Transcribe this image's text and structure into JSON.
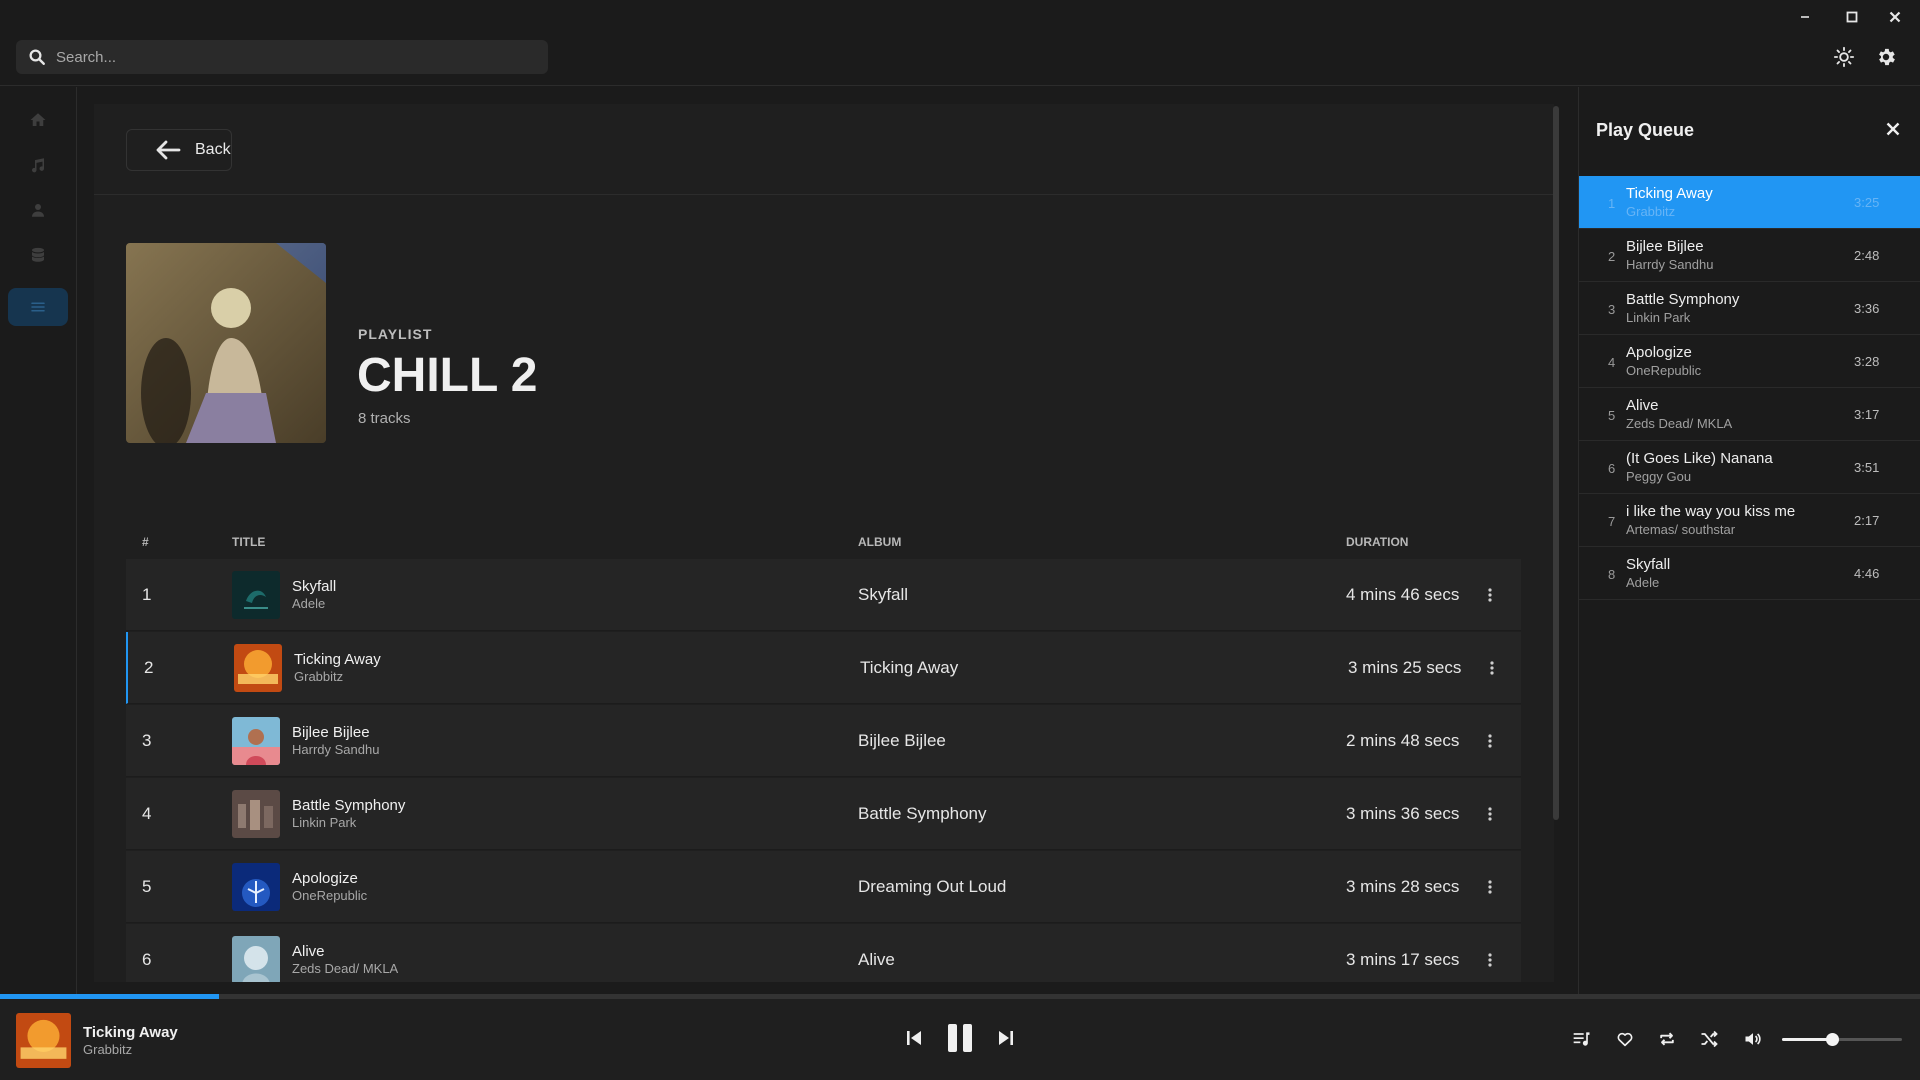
{
  "search": {
    "placeholder": "Search..."
  },
  "window_controls": [
    "minimize-icon",
    "maximize-icon",
    "close-icon"
  ],
  "top_icons": [
    "sun-icon",
    "gear-icon"
  ],
  "nav": {
    "items": [
      {
        "icon": "home-icon",
        "active": false
      },
      {
        "icon": "music-note-icon",
        "active": false
      },
      {
        "icon": "person-icon",
        "active": false
      },
      {
        "icon": "database-icon",
        "active": false
      },
      {
        "icon": "list-icon",
        "active": true
      }
    ]
  },
  "main": {
    "back_label": "Back",
    "playlist": {
      "type_label": "PLAYLIST",
      "title": "CHILL 2",
      "count_label": "8 tracks"
    },
    "table": {
      "headers": {
        "num": "#",
        "title": "TITLE",
        "album": "ALBUM",
        "duration": "DURATION"
      },
      "rows": [
        {
          "num": "1",
          "title": "Skyfall",
          "artist": "Adele",
          "album": "Skyfall",
          "duration": "4 mins 46 secs",
          "playing": false
        },
        {
          "num": "2",
          "title": "Ticking Away",
          "artist": "Grabbitz",
          "album": "Ticking Away",
          "duration": "3 mins 25 secs",
          "playing": true
        },
        {
          "num": "3",
          "title": "Bijlee Bijlee",
          "artist": "Harrdy Sandhu",
          "album": "Bijlee Bijlee",
          "duration": "2 mins 48 secs",
          "playing": false
        },
        {
          "num": "4",
          "title": "Battle Symphony",
          "artist": "Linkin Park",
          "album": "Battle Symphony",
          "duration": "3 mins 36 secs",
          "playing": false
        },
        {
          "num": "5",
          "title": "Apologize",
          "artist": "OneRepublic",
          "album": "Dreaming Out Loud",
          "duration": "3 mins 28 secs",
          "playing": false
        },
        {
          "num": "6",
          "title": "Alive",
          "artist": "Zeds Dead/ MKLA",
          "album": "Alive",
          "duration": "3 mins 17 secs",
          "playing": false
        }
      ]
    }
  },
  "queue": {
    "title": "Play Queue",
    "items": [
      {
        "num": "1",
        "title": "Ticking Away",
        "artist": "Grabbitz",
        "duration": "3:25",
        "current": true
      },
      {
        "num": "2",
        "title": "Bijlee Bijlee",
        "artist": "Harrdy Sandhu",
        "duration": "2:48",
        "current": false
      },
      {
        "num": "3",
        "title": "Battle Symphony",
        "artist": "Linkin Park",
        "duration": "3:36",
        "current": false
      },
      {
        "num": "4",
        "title": "Apologize",
        "artist": "OneRepublic",
        "duration": "3:28",
        "current": false
      },
      {
        "num": "5",
        "title": "Alive",
        "artist": "Zeds Dead/ MKLA",
        "duration": "3:17",
        "current": false
      },
      {
        "num": "6",
        "title": "(It Goes Like) Nanana",
        "artist": "Peggy Gou",
        "duration": "3:51",
        "current": false
      },
      {
        "num": "7",
        "title": "i like the way you kiss me",
        "artist": "Artemas/ southstar",
        "duration": "2:17",
        "current": false
      },
      {
        "num": "8",
        "title": "Skyfall",
        "artist": "Adele",
        "duration": "4:46",
        "current": false
      }
    ]
  },
  "player": {
    "now_playing": {
      "title": "Ticking Away",
      "artist": "Grabbitz"
    },
    "progress_fraction": 0.114,
    "volume_fraction": 0.42,
    "accent_color": "#2196f3"
  }
}
